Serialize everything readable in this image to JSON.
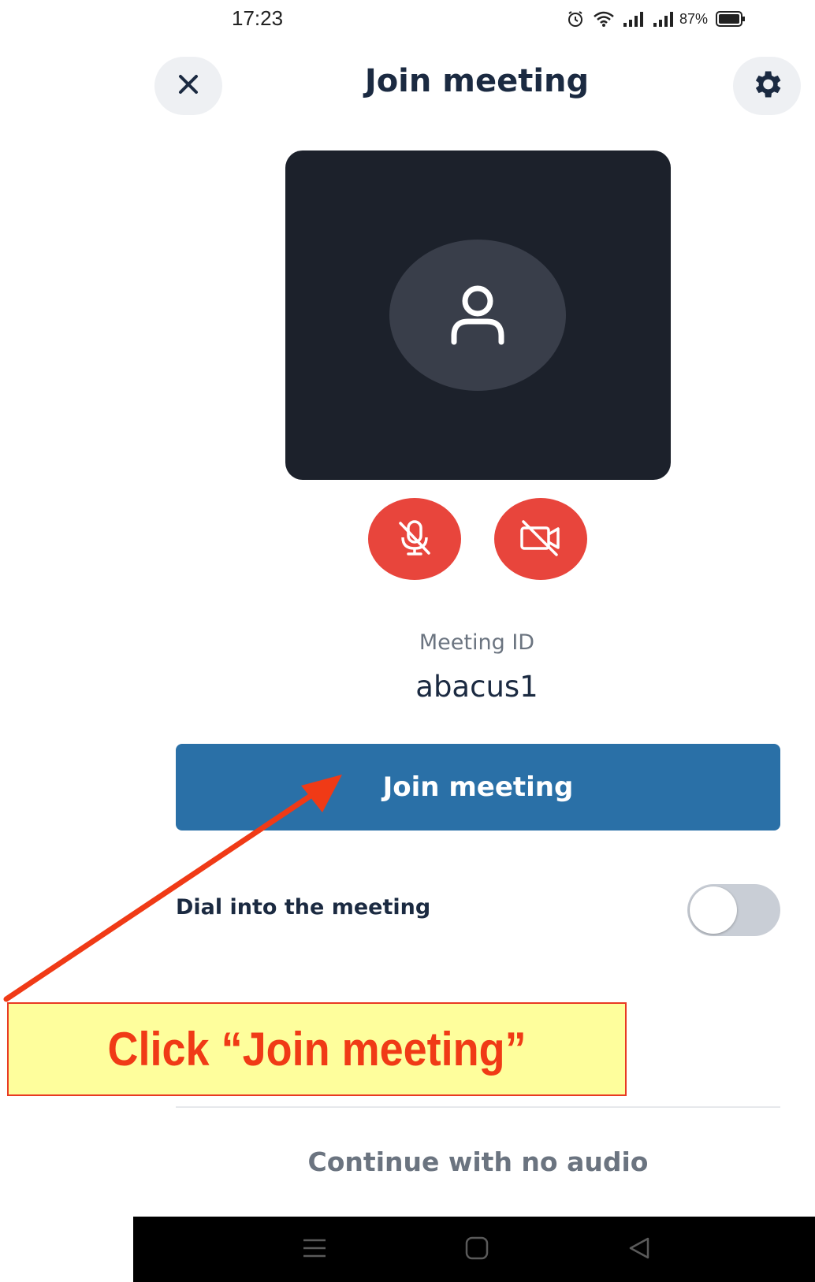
{
  "status_bar": {
    "time": "17:23",
    "battery": "87%",
    "icons": [
      "alarm-icon",
      "wifi-icon",
      "signal-icon",
      "signal-icon",
      "battery-icon"
    ]
  },
  "header": {
    "title": "Join meeting",
    "close_icon": "close-icon",
    "settings_icon": "gear-icon"
  },
  "preview": {
    "avatar_icon": "person-icon",
    "mic": {
      "icon": "mic-off-icon",
      "state": "muted"
    },
    "camera": {
      "icon": "camera-off-icon",
      "state": "off"
    }
  },
  "meeting": {
    "id_label": "Meeting ID",
    "id_value": "abacus1"
  },
  "join_button": "Join meeting",
  "dial_in": {
    "label": "Dial into the meeting",
    "enabled": false
  },
  "continue_no_audio": "Continue with no audio",
  "nav_bar": {
    "buttons": [
      "menu-icon",
      "home-icon",
      "back-icon"
    ]
  },
  "annotation": {
    "text": "Click “Join meeting”",
    "color": "#f03a16",
    "background": "#fefe9c"
  },
  "colors": {
    "primary": "#2a70a7",
    "danger": "#e8453c",
    "title": "#1b2a41",
    "muted_text": "#6b7480"
  }
}
